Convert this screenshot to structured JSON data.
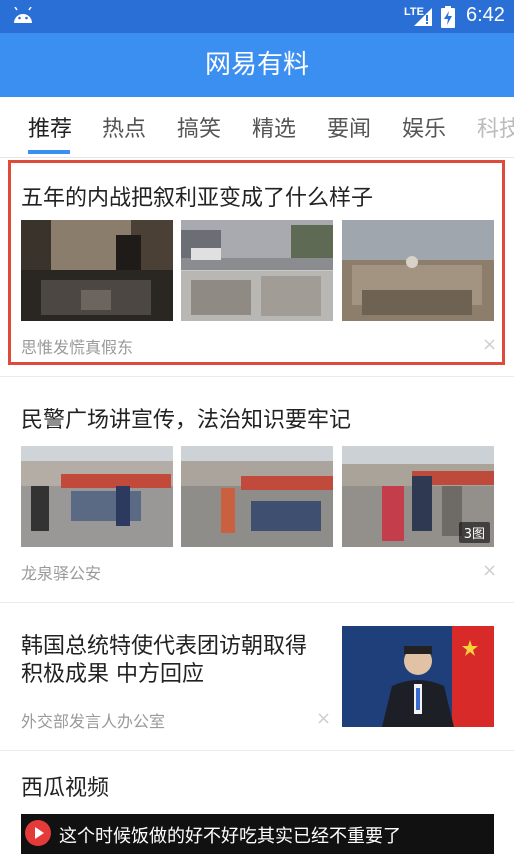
{
  "statusbar": {
    "network": "LTE",
    "time": "6:42"
  },
  "app": {
    "title": "网易有料"
  },
  "tabs": [
    {
      "label": "推荐"
    },
    {
      "label": "热点"
    },
    {
      "label": "搞笑"
    },
    {
      "label": "精选"
    },
    {
      "label": "要闻"
    },
    {
      "label": "娱乐"
    },
    {
      "label": "科技"
    }
  ],
  "feed": [
    {
      "title": "五年的内战把叙利亚变成了什么样子",
      "source": "思惟发慌真假东",
      "close": "×"
    },
    {
      "title": "民警广场讲宣传，法治知识要牢记",
      "source": "龙泉驿公安",
      "close": "×",
      "image_count": "3图"
    },
    {
      "title_line1": "韩国总统特使代表团访朝取得",
      "title_line2": "积极成果 中方回应",
      "source": "外交部发言人办公室",
      "close": "×"
    },
    {
      "title": "西瓜视频",
      "video_caption": "这个时候饭做的好不好吃其实已经不重要了"
    }
  ]
}
